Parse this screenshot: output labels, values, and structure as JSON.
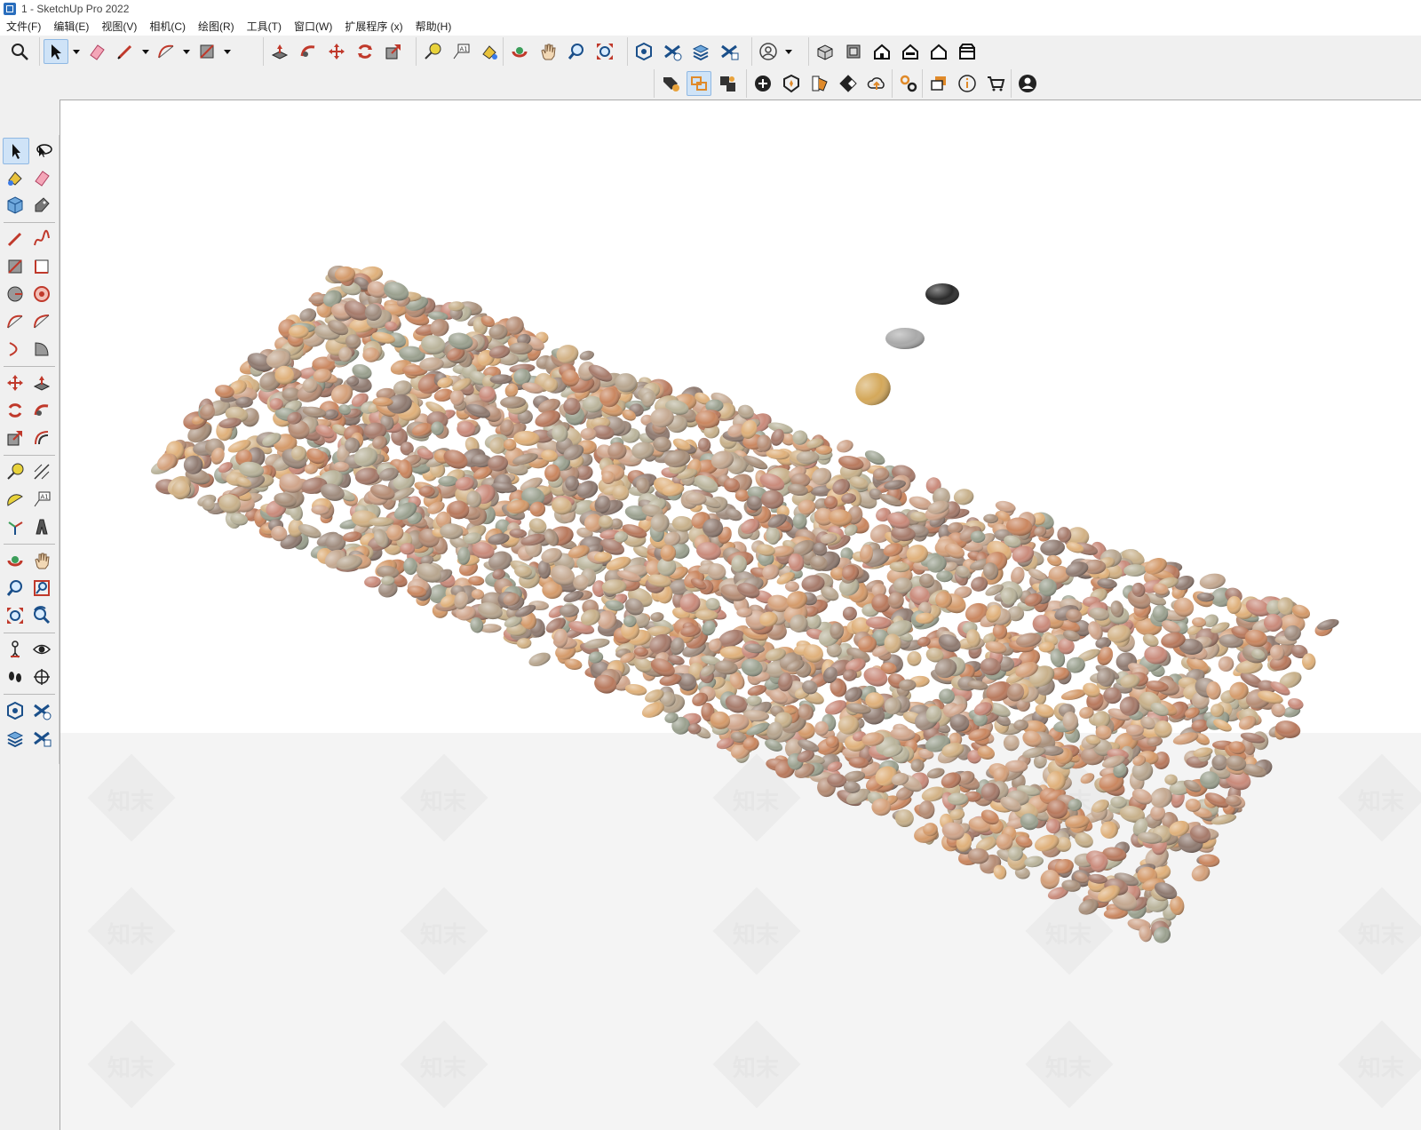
{
  "window": {
    "title": "1 - SketchUp Pro 2022"
  },
  "menu": [
    {
      "label": "文件(F)"
    },
    {
      "label": "编辑(E)"
    },
    {
      "label": "视图(V)"
    },
    {
      "label": "相机(C)"
    },
    {
      "label": "绘图(R)"
    },
    {
      "label": "工具(T)"
    },
    {
      "label": "窗口(W)"
    },
    {
      "label": "扩展程序 (x)"
    },
    {
      "label": "帮助(H)"
    }
  ],
  "toolbar": {
    "row1": [
      "search-icon",
      "select-icon",
      "eraser-icon",
      "pencil-icon",
      "arc-icon",
      "rectangle-icon",
      "pushpull-icon",
      "followme-icon",
      "move-icon",
      "rotate-icon",
      "scale-icon",
      "tape-icon",
      "text-icon",
      "paint-icon",
      "orbit-icon",
      "pan-icon",
      "zoom-icon",
      "zoom-extents-icon",
      "warehouse-icon",
      "extension-warehouse-icon",
      "layers-icon",
      "components-icon",
      "account-icon",
      "house-views-icon"
    ],
    "row2": [
      "tag-icon",
      "section-icon",
      "scene-icon",
      "add-icon",
      "styles-icon",
      "materials-icon",
      "checker-icon",
      "cloud-icon",
      "settings-icon",
      "chat-icon",
      "info-icon",
      "cart-icon",
      "user-icon"
    ]
  },
  "watermark": {
    "text": "知末"
  },
  "colors": {
    "accent": "#2a6ebd",
    "active_tool": "#cfe3f7",
    "ground": "#f4f4f4",
    "sky": "#ffffff"
  }
}
